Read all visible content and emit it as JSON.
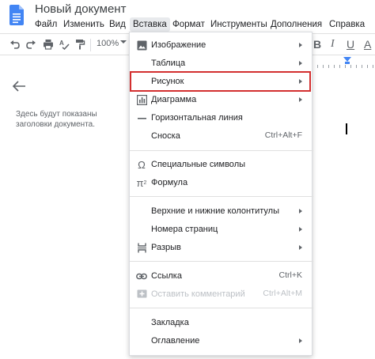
{
  "app": {
    "doc_title": "Новый документ",
    "doc_icon": "google-docs-icon"
  },
  "menubar": {
    "items": [
      "Файл",
      "Изменить",
      "Вид",
      "Вставка",
      "Формат",
      "Инструменты",
      "Дополнения",
      "Справка"
    ],
    "active": "Вставка"
  },
  "toolbar": {
    "undo_icon": "undo-icon",
    "redo_icon": "redo-icon",
    "print_icon": "print-icon",
    "spellcheck_icon": "spellcheck-icon",
    "paint_format_icon": "paint-format-icon",
    "zoom": "100%",
    "bold": "B",
    "italic": "I",
    "underline": "U",
    "text_color": "A"
  },
  "outline": {
    "back_icon": "arrow-back-icon",
    "text": "Здесь будут показаны заголовки документа."
  },
  "insert_menu": {
    "items": [
      {
        "label": "Изображение",
        "icon": "image-icon",
        "submenu": true
      },
      {
        "label": "Таблица",
        "icon": "",
        "submenu": true
      },
      {
        "label": "Рисунок",
        "icon": "",
        "submenu": true,
        "highlighted": true
      },
      {
        "label": "Диаграмма",
        "icon": "chart-icon",
        "submenu": true
      },
      {
        "label": "Горизонтальная линия",
        "icon": "horizontal-line-icon",
        "submenu": false
      },
      {
        "label": "Сноска",
        "icon": "",
        "shortcut": "Ctrl+Alt+F"
      },
      {
        "label": "Специальные символы",
        "icon": "omega-icon",
        "submenu": false
      },
      {
        "label": "Формула",
        "icon": "pi-icon",
        "submenu": false
      },
      {
        "label": "Верхние и нижние колонтитулы",
        "icon": "",
        "submenu": true
      },
      {
        "label": "Номера страниц",
        "icon": "",
        "submenu": true
      },
      {
        "label": "Разрыв",
        "icon": "page-break-icon",
        "submenu": true
      },
      {
        "label": "Ссылка",
        "icon": "link-icon",
        "shortcut": "Ctrl+K"
      },
      {
        "label": "Оставить комментарий",
        "icon": "add-comment-icon",
        "shortcut": "Ctrl+Alt+M",
        "disabled": true
      },
      {
        "label": "Закладка",
        "icon": "",
        "submenu": false
      },
      {
        "label": "Оглавление",
        "icon": "",
        "submenu": true
      }
    ]
  },
  "colors": {
    "highlight_border": "#d32f2f",
    "doc_icon": "#4285f4",
    "active_menu_bg": "#e8eaed"
  }
}
